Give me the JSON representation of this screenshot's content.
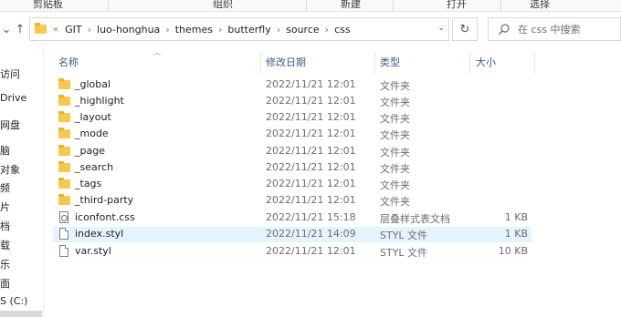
{
  "ribbon": {
    "groups": [
      "剪贴板",
      "组织",
      "新建",
      "打开",
      "选择"
    ]
  },
  "nav": {
    "down_arrow": "⌄",
    "up_arrow": "↑"
  },
  "address": {
    "overflow": "«",
    "crumbs": [
      "GIT",
      "luo-honghua",
      "themes",
      "butterfly",
      "source",
      "css"
    ],
    "separator": "›",
    "dropdown": "⌄",
    "refresh": "↻"
  },
  "search": {
    "placeholder": "在 css 中搜索"
  },
  "sidebar": {
    "items": [
      "访问",
      "Drive",
      "网盘",
      "脑",
      "对象",
      "频",
      "片",
      "档",
      "载",
      "乐",
      "面",
      "S (C:)"
    ]
  },
  "columns": {
    "name": "名称",
    "modified": "修改日期",
    "type": "类型",
    "size": "大小"
  },
  "files": [
    {
      "name": "_global",
      "modified": "2022/11/21 12:01",
      "type": "文件夹",
      "size": "",
      "kind": "folder"
    },
    {
      "name": "_highlight",
      "modified": "2022/11/21 12:01",
      "type": "文件夹",
      "size": "",
      "kind": "folder"
    },
    {
      "name": "_layout",
      "modified": "2022/11/21 12:01",
      "type": "文件夹",
      "size": "",
      "kind": "folder"
    },
    {
      "name": "_mode",
      "modified": "2022/11/21 12:01",
      "type": "文件夹",
      "size": "",
      "kind": "folder"
    },
    {
      "name": "_page",
      "modified": "2022/11/21 12:01",
      "type": "文件夹",
      "size": "",
      "kind": "folder"
    },
    {
      "name": "_search",
      "modified": "2022/11/21 12:01",
      "type": "文件夹",
      "size": "",
      "kind": "folder"
    },
    {
      "name": "_tags",
      "modified": "2022/11/21 12:01",
      "type": "文件夹",
      "size": "",
      "kind": "folder"
    },
    {
      "name": "_third-party",
      "modified": "2022/11/21 12:01",
      "type": "文件夹",
      "size": "",
      "kind": "folder"
    },
    {
      "name": "iconfont.css",
      "modified": "2022/11/21 15:18",
      "type": "层叠样式表文档",
      "size": "1 KB",
      "kind": "css"
    },
    {
      "name": "index.styl",
      "modified": "2022/11/21 14:09",
      "type": "STYL 文件",
      "size": "1 KB",
      "kind": "file"
    },
    {
      "name": "var.styl",
      "modified": "2022/11/21 12:01",
      "type": "STYL 文件",
      "size": "10 KB",
      "kind": "file"
    }
  ],
  "colors": {
    "folder": "#f6c94a",
    "header_text": "#3c5a8a",
    "hover_row": "#e5f3ff"
  }
}
